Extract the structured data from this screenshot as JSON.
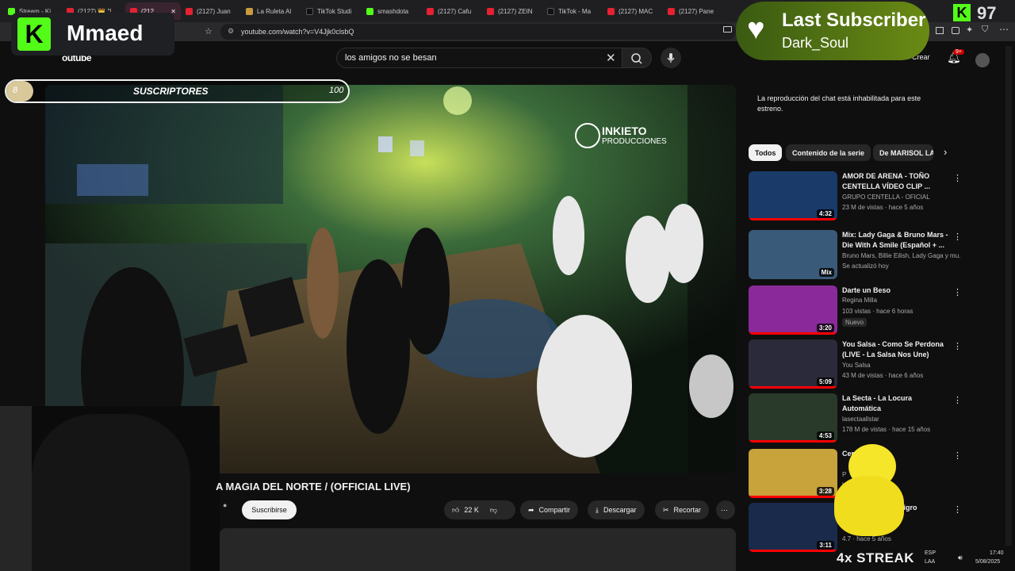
{
  "tabs": [
    {
      "label": "Stream - Ki",
      "icon": "kick-icon"
    },
    {
      "label": "(2127) 👑 ″!",
      "icon": "youtube-icon"
    },
    {
      "label": "(212",
      "icon": "youtube-icon",
      "active": true
    },
    {
      "label": "(2127) Juan",
      "icon": "youtube-icon"
    },
    {
      "label": "La Ruleta Al",
      "icon": "roulette-icon"
    },
    {
      "label": "TikTok Studi",
      "icon": "tiktok-icon"
    },
    {
      "label": "smashdota",
      "icon": "kick-icon"
    },
    {
      "label": "(2127) Cafu",
      "icon": "youtube-icon"
    },
    {
      "label": "(2127) ZEIN",
      "icon": "youtube-icon"
    },
    {
      "label": "TikTok - Ma",
      "icon": "tiktok-icon"
    },
    {
      "label": "(2127) MAC",
      "icon": "youtube-icon"
    },
    {
      "label": "(2127) Pane",
      "icon": "youtube-icon"
    }
  ],
  "address": {
    "url": "youtube.com/watch?v=V4Jjk0clsbQ"
  },
  "youtube": {
    "logo_text": "outube",
    "search_value": "los amigos no se besan",
    "create_label": "Crear",
    "notif_count": "9+"
  },
  "video": {
    "watermark_line1": "INKIETO",
    "watermark_line2": "PRODUCCIONES",
    "title": "A MAGIA DEL NORTE / (OFFICIAL LIVE)",
    "subscribe_label": "Suscribirse",
    "likes": "22 K",
    "share_label": "Compartir",
    "download_label": "Descargar",
    "clip_label": "Recortar"
  },
  "chat_note": "La reproducción del chat está inhabilitada para este estreno.",
  "chips": [
    "Todos",
    "Contenido de la serie",
    "De MARISOL LA"
  ],
  "recommendations": [
    {
      "title": "AMOR DE ARENA - TOÑO CENTELLA  VÍDEO CLIP ...",
      "channel": "GRUPO CENTELLA - OFICIAL",
      "meta": "23 M de vistas · hace 5 años",
      "duration": "4:32",
      "verified": true,
      "thumb_color": "#1a3a6a"
    },
    {
      "title": "Mix: Lady Gaga & Bruno Mars - Die With A Smile (Español + ...",
      "channel": "Bruno Mars, Billie Eilish, Lady Gaga y mu...",
      "meta": "Se actualizó hoy",
      "duration": "Mix",
      "verified": false,
      "thumb_color": "#3a5a7a"
    },
    {
      "title": "Darte un Beso",
      "channel": "Regina Milla",
      "meta": "103 vistas · hace 6 horas",
      "badge": "Nuevo",
      "duration": "3:20",
      "verified": true,
      "thumb_color": "#8a2a9a"
    },
    {
      "title": "You Salsa - Como Se Perdona (LIVE - La Salsa Nos Une)",
      "channel": "You Salsa",
      "meta": "43 M de vistas · hace 6 años",
      "duration": "5:09",
      "verified": true,
      "thumb_color": "#2a2a3a"
    },
    {
      "title": "La Secta - La Locura Automática",
      "channel": "lasectaallstar",
      "meta": "178 M de vistas · hace 15 años",
      "duration": "4:53",
      "verified": true,
      "thumb_color": "#2a3a2a"
    },
    {
      "title": "Cerv",
      "channel": "P",
      "meta": "hace 8 meses",
      "duration": "3:28",
      "verified": false,
      "thumb_color": "#c8a23a"
    },
    {
      "title": "e Luna, Ricardo eligro (Official...",
      "channel": "",
      "meta": "4.7 · hace 5 años",
      "duration": "3:11",
      "verified": true,
      "thumb_color": "#1a2a4a"
    }
  ],
  "overlay": {
    "kick_name": "Mmaed",
    "last_sub_title": "Last Subscriber",
    "last_sub_name": "Dark_Soul",
    "viewer_count": "97",
    "subs_current": "8",
    "subs_label": "SUSCRIPTORES",
    "subs_goal": "100",
    "subs_progress": 0.08,
    "streak": "4x STREAK"
  },
  "taskbar": {
    "lang1": "ESP",
    "lang2": "LAA",
    "time": "17:40",
    "date": "5/08/2025"
  },
  "colors": {
    "kick_green": "#53fc18",
    "yt_red": "#ff0000",
    "bg": "#0f0f0f"
  }
}
